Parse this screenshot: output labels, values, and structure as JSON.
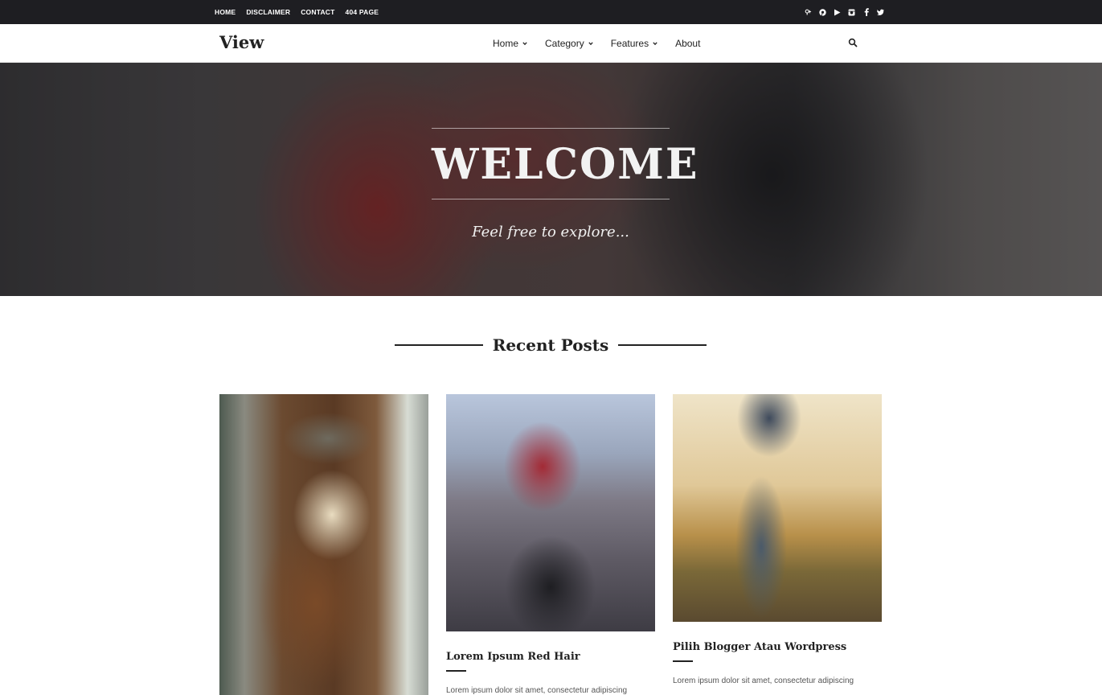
{
  "topbar": {
    "links": [
      "HOME",
      "DISCLAIMER",
      "CONTACT",
      "404 PAGE"
    ],
    "social_icons": [
      "google-plus-icon",
      "pinterest-icon",
      "youtube-icon",
      "instagram-icon",
      "facebook-icon",
      "twitter-icon"
    ]
  },
  "header": {
    "logo": "View",
    "nav": [
      {
        "label": "Home",
        "dropdown": true
      },
      {
        "label": "Category",
        "dropdown": true
      },
      {
        "label": "Features",
        "dropdown": true
      },
      {
        "label": "About",
        "dropdown": false
      }
    ],
    "search_icon": "search-icon"
  },
  "hero": {
    "title": "WELCOME",
    "subtitle": "Feel free to explore..."
  },
  "section": {
    "title": "Recent Posts"
  },
  "posts": [
    {
      "title": "",
      "excerpt": ""
    },
    {
      "title": "Lorem Ipsum Red Hair",
      "excerpt": "Lorem ipsum dolor sit amet, consectetur adipiscing"
    },
    {
      "title": "Pilih Blogger Atau Wordpress",
      "excerpt": "Lorem ipsum dolor sit amet, consectetur adipiscing"
    }
  ],
  "colors": {
    "topbar_bg": "#1e1e22",
    "text_dark": "#222222",
    "background": "#ffffff"
  }
}
